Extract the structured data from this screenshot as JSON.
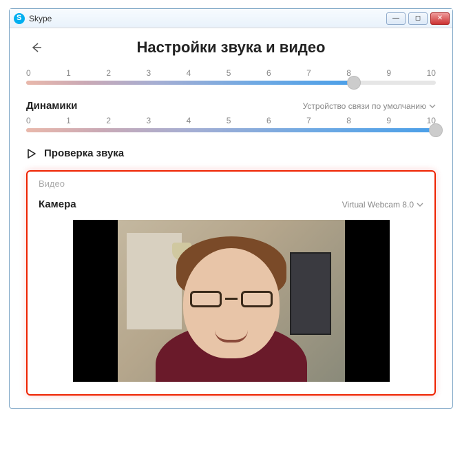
{
  "window": {
    "title": "Skype"
  },
  "page": {
    "title": "Настройки звука и видео"
  },
  "ticks": [
    "0",
    "1",
    "2",
    "3",
    "4",
    "5",
    "6",
    "7",
    "8",
    "9",
    "10"
  ],
  "slider1": {
    "value": 80
  },
  "speakers": {
    "label": "Динамики",
    "device": "Устройство связи по умолчанию"
  },
  "slider2": {
    "value": 100
  },
  "audiotest": {
    "label": "Проверка звука"
  },
  "video": {
    "heading": "Видео",
    "camera_label": "Камера",
    "camera_device": "Virtual Webcam 8.0"
  }
}
